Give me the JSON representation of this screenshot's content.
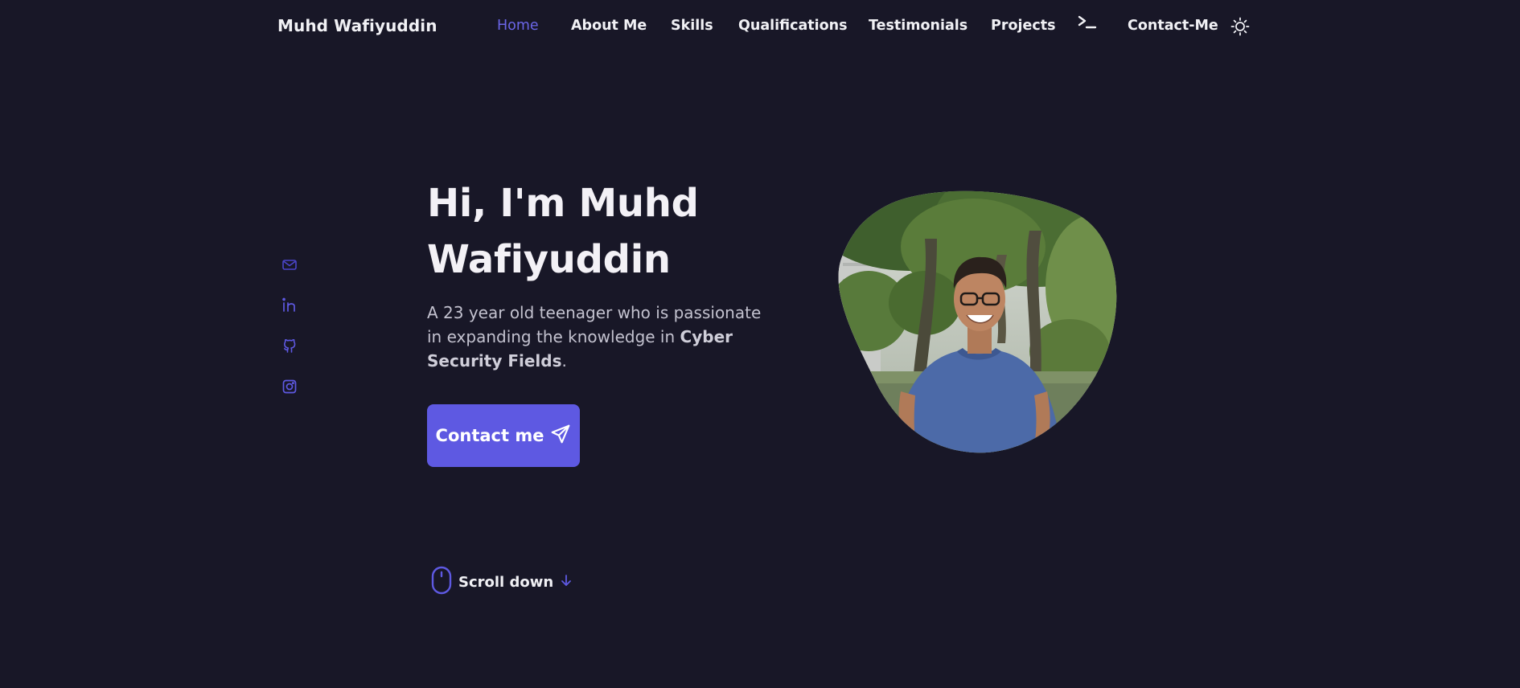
{
  "header": {
    "logo": "Muhd Wafiyuddin",
    "nav": [
      {
        "label": "Home",
        "active": true
      },
      {
        "label": "About Me"
      },
      {
        "label": "Skills"
      },
      {
        "label": "Qualifications"
      },
      {
        "label": "Testimonials"
      },
      {
        "label": "Projects"
      },
      {
        "label": "Contact-Me"
      }
    ],
    "icons": {
      "terminal": "terminal-icon",
      "theme": "sun-icon"
    }
  },
  "social": [
    {
      "icon": "email-icon"
    },
    {
      "icon": "linkedin-icon"
    },
    {
      "icon": "github-icon"
    },
    {
      "icon": "instagram-icon"
    }
  ],
  "hero": {
    "title": "Hi, I'm Muhd Wafiyuddin",
    "desc_prefix": "A 23 year old teenager who is passionate in expanding the knowledge in ",
    "desc_bold": "Cyber Security Fields",
    "desc_suffix": ".",
    "button_label": "Contact me",
    "button_icon": "send-icon",
    "scroll_label": "Scroll down",
    "scroll_icons": [
      "mouse-icon",
      "arrow-down-icon"
    ]
  },
  "colors": {
    "background": "#181727",
    "accent": "#5e59e2",
    "text": "#f1f1f5"
  }
}
